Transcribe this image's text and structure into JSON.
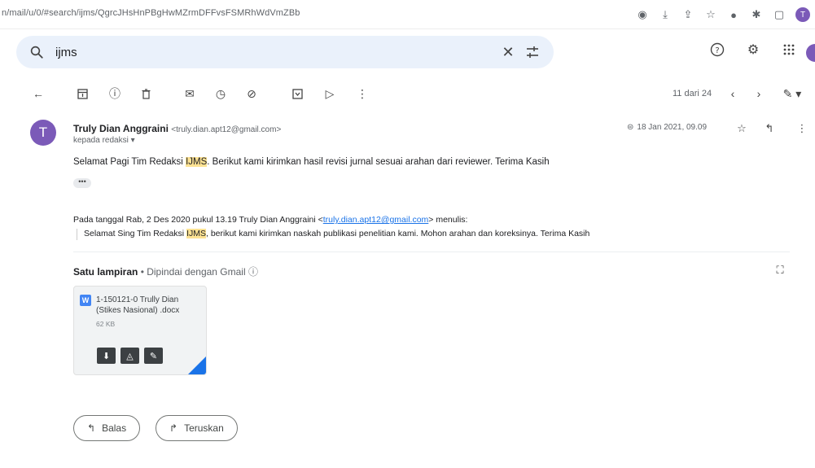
{
  "browser": {
    "url": "n/mail/u/0/#search/ijms/QgrcJHsHnPBgHwMZrmDFFvsFSMRhWdVmZBb",
    "profile_initial": "T"
  },
  "search": {
    "value": "ijms"
  },
  "toolbar": {
    "pager_text": "11 dari 24"
  },
  "message": {
    "avatar_initial": "T",
    "sender_name": "Truly Dian Anggraini",
    "sender_email": "<truly.dian.apt12@gmail.com>",
    "recipient": "kepada redaksi ▾",
    "date": "18 Jan 2021, 09.09",
    "body_before": "Selamat Pagi Tim Redaksi ",
    "body_highlight": "IJMS",
    "body_after": ". Berikut kami kirimkan hasil revisi jurnal sesuai arahan dari reviewer. Terima Kasih",
    "ellipsis": "•••"
  },
  "quote": {
    "intro_before": "Pada tanggal Rab, 2 Des 2020 pukul 13.19 Truly Dian Anggraini <",
    "intro_link": "truly.dian.apt12@gmail.com",
    "intro_after": "> menulis:",
    "text_before": "Selamat Sing Tim Redaksi ",
    "text_highlight": "IJMS",
    "text_after": ", berikut kami kirimkan naskah publikasi penelitian kami. Mohon arahan dan koreksinya. Terima Kasih"
  },
  "attachments": {
    "title": "Satu lampiran",
    "subtitle": " • Dipindai dengan Gmail ⓘ",
    "file": {
      "badge": "W",
      "name": "1-150121-0 Trully Dian (Stikes Nasional) .docx",
      "size": "62 KB"
    }
  },
  "actions": {
    "reply_label": "Balas",
    "forward_label": "Teruskan"
  },
  "colors": {
    "avatar": "#7b5ab8",
    "search_bg": "#eaf1fb",
    "highlight": "#fde293",
    "link": "#1a73e8"
  }
}
